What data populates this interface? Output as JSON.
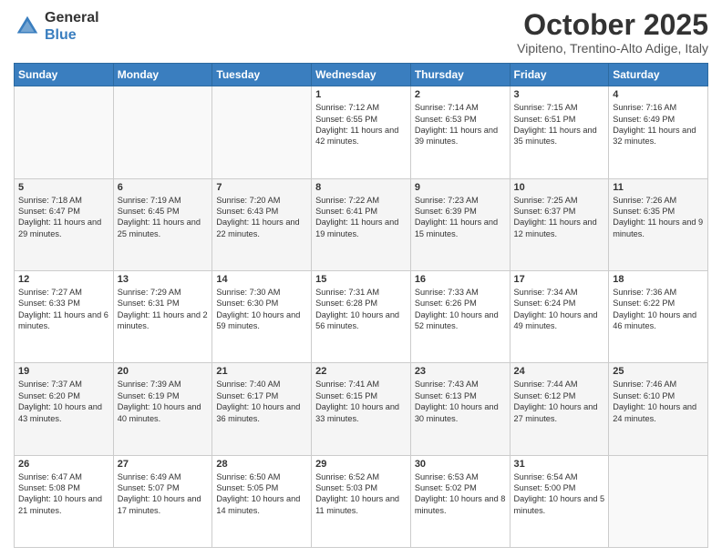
{
  "header": {
    "logo_general": "General",
    "logo_blue": "Blue",
    "month": "October 2025",
    "location": "Vipiteno, Trentino-Alto Adige, Italy"
  },
  "days_of_week": [
    "Sunday",
    "Monday",
    "Tuesday",
    "Wednesday",
    "Thursday",
    "Friday",
    "Saturday"
  ],
  "weeks": [
    [
      {
        "day": "",
        "info": ""
      },
      {
        "day": "",
        "info": ""
      },
      {
        "day": "",
        "info": ""
      },
      {
        "day": "1",
        "info": "Sunrise: 7:12 AM\nSunset: 6:55 PM\nDaylight: 11 hours and 42 minutes."
      },
      {
        "day": "2",
        "info": "Sunrise: 7:14 AM\nSunset: 6:53 PM\nDaylight: 11 hours and 39 minutes."
      },
      {
        "day": "3",
        "info": "Sunrise: 7:15 AM\nSunset: 6:51 PM\nDaylight: 11 hours and 35 minutes."
      },
      {
        "day": "4",
        "info": "Sunrise: 7:16 AM\nSunset: 6:49 PM\nDaylight: 11 hours and 32 minutes."
      }
    ],
    [
      {
        "day": "5",
        "info": "Sunrise: 7:18 AM\nSunset: 6:47 PM\nDaylight: 11 hours and 29 minutes."
      },
      {
        "day": "6",
        "info": "Sunrise: 7:19 AM\nSunset: 6:45 PM\nDaylight: 11 hours and 25 minutes."
      },
      {
        "day": "7",
        "info": "Sunrise: 7:20 AM\nSunset: 6:43 PM\nDaylight: 11 hours and 22 minutes."
      },
      {
        "day": "8",
        "info": "Sunrise: 7:22 AM\nSunset: 6:41 PM\nDaylight: 11 hours and 19 minutes."
      },
      {
        "day": "9",
        "info": "Sunrise: 7:23 AM\nSunset: 6:39 PM\nDaylight: 11 hours and 15 minutes."
      },
      {
        "day": "10",
        "info": "Sunrise: 7:25 AM\nSunset: 6:37 PM\nDaylight: 11 hours and 12 minutes."
      },
      {
        "day": "11",
        "info": "Sunrise: 7:26 AM\nSunset: 6:35 PM\nDaylight: 11 hours and 9 minutes."
      }
    ],
    [
      {
        "day": "12",
        "info": "Sunrise: 7:27 AM\nSunset: 6:33 PM\nDaylight: 11 hours and 6 minutes."
      },
      {
        "day": "13",
        "info": "Sunrise: 7:29 AM\nSunset: 6:31 PM\nDaylight: 11 hours and 2 minutes."
      },
      {
        "day": "14",
        "info": "Sunrise: 7:30 AM\nSunset: 6:30 PM\nDaylight: 10 hours and 59 minutes."
      },
      {
        "day": "15",
        "info": "Sunrise: 7:31 AM\nSunset: 6:28 PM\nDaylight: 10 hours and 56 minutes."
      },
      {
        "day": "16",
        "info": "Sunrise: 7:33 AM\nSunset: 6:26 PM\nDaylight: 10 hours and 52 minutes."
      },
      {
        "day": "17",
        "info": "Sunrise: 7:34 AM\nSunset: 6:24 PM\nDaylight: 10 hours and 49 minutes."
      },
      {
        "day": "18",
        "info": "Sunrise: 7:36 AM\nSunset: 6:22 PM\nDaylight: 10 hours and 46 minutes."
      }
    ],
    [
      {
        "day": "19",
        "info": "Sunrise: 7:37 AM\nSunset: 6:20 PM\nDaylight: 10 hours and 43 minutes."
      },
      {
        "day": "20",
        "info": "Sunrise: 7:39 AM\nSunset: 6:19 PM\nDaylight: 10 hours and 40 minutes."
      },
      {
        "day": "21",
        "info": "Sunrise: 7:40 AM\nSunset: 6:17 PM\nDaylight: 10 hours and 36 minutes."
      },
      {
        "day": "22",
        "info": "Sunrise: 7:41 AM\nSunset: 6:15 PM\nDaylight: 10 hours and 33 minutes."
      },
      {
        "day": "23",
        "info": "Sunrise: 7:43 AM\nSunset: 6:13 PM\nDaylight: 10 hours and 30 minutes."
      },
      {
        "day": "24",
        "info": "Sunrise: 7:44 AM\nSunset: 6:12 PM\nDaylight: 10 hours and 27 minutes."
      },
      {
        "day": "25",
        "info": "Sunrise: 7:46 AM\nSunset: 6:10 PM\nDaylight: 10 hours and 24 minutes."
      }
    ],
    [
      {
        "day": "26",
        "info": "Sunrise: 6:47 AM\nSunset: 5:08 PM\nDaylight: 10 hours and 21 minutes."
      },
      {
        "day": "27",
        "info": "Sunrise: 6:49 AM\nSunset: 5:07 PM\nDaylight: 10 hours and 17 minutes."
      },
      {
        "day": "28",
        "info": "Sunrise: 6:50 AM\nSunset: 5:05 PM\nDaylight: 10 hours and 14 minutes."
      },
      {
        "day": "29",
        "info": "Sunrise: 6:52 AM\nSunset: 5:03 PM\nDaylight: 10 hours and 11 minutes."
      },
      {
        "day": "30",
        "info": "Sunrise: 6:53 AM\nSunset: 5:02 PM\nDaylight: 10 hours and 8 minutes."
      },
      {
        "day": "31",
        "info": "Sunrise: 6:54 AM\nSunset: 5:00 PM\nDaylight: 10 hours and 5 minutes."
      },
      {
        "day": "",
        "info": ""
      }
    ]
  ]
}
